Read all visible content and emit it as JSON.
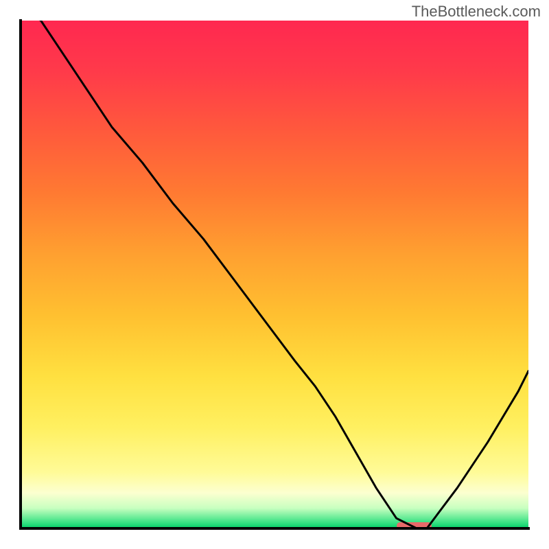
{
  "watermark": "TheBottleneck.com",
  "colors": {
    "curve": "#000000",
    "marker": "#e86a6a",
    "frame": "#000000",
    "gradient_top": "#ff2850",
    "gradient_bottom": "#00cc66"
  },
  "chart_data": {
    "type": "line",
    "title": "",
    "xlabel": "",
    "ylabel": "",
    "xlim": [
      0,
      100
    ],
    "ylim": [
      0,
      100
    ],
    "x": [
      0,
      4,
      10,
      18,
      24,
      30,
      36,
      42,
      48,
      54,
      58,
      62,
      66,
      70,
      74,
      78,
      80,
      86,
      92,
      98,
      100
    ],
    "values": [
      103,
      100,
      91,
      79,
      72,
      64,
      57,
      49,
      41,
      33,
      28,
      22,
      15,
      8,
      2,
      0,
      0,
      8,
      17,
      27,
      31
    ],
    "gradient_colors": [
      "#ff2850",
      "#ff7a32",
      "#ffe040",
      "#fffb98",
      "#30e080",
      "#00cc66"
    ],
    "marker": {
      "x_start": 74,
      "x_end": 81,
      "y": 0
    },
    "note": "Values estimated from pixel positions; y=100 is top of plot, y=0 is bottom baseline."
  }
}
